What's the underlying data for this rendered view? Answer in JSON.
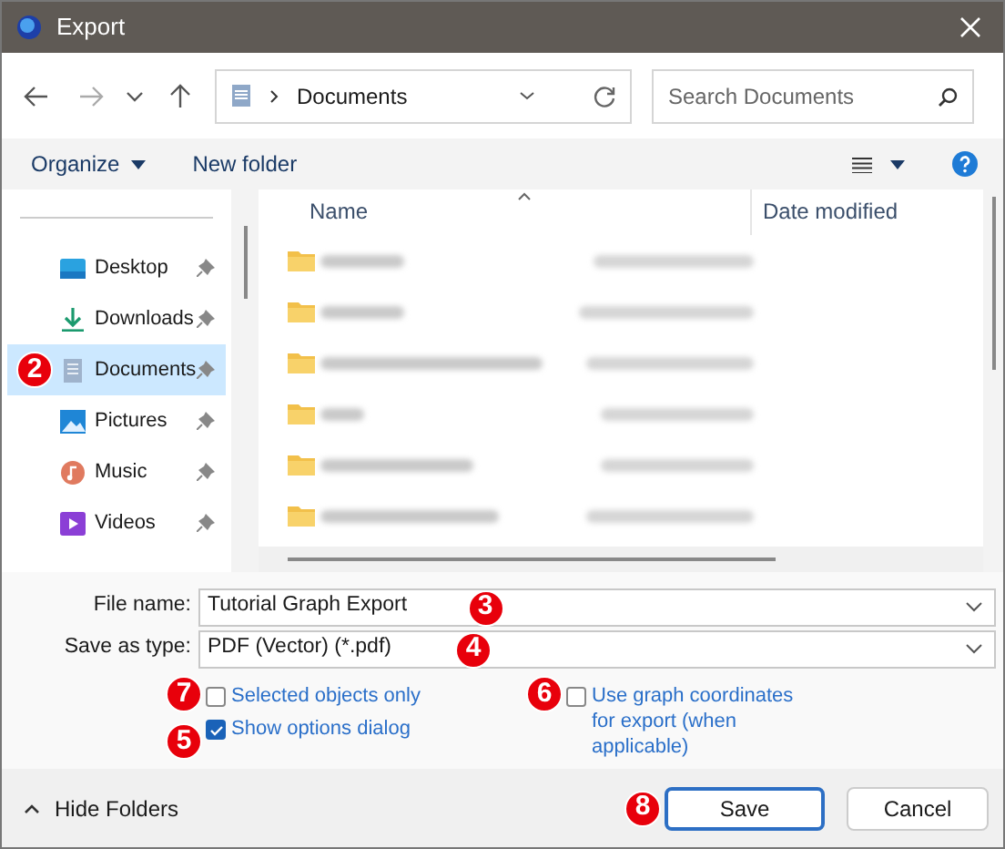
{
  "window": {
    "title": "Export"
  },
  "nav": {
    "location": "Documents",
    "search": {
      "placeholder": "Search Documents"
    }
  },
  "toolbar": {
    "organize": "Organize",
    "new_folder": "New folder"
  },
  "sidebar": {
    "items": [
      {
        "kind": "desktop",
        "label": "Desktop",
        "selected": false
      },
      {
        "kind": "downloads",
        "label": "Downloads",
        "selected": false
      },
      {
        "kind": "documents",
        "label": "Documents",
        "selected": true,
        "marker": "2"
      },
      {
        "kind": "pictures",
        "label": "Pictures",
        "selected": false
      },
      {
        "kind": "music",
        "label": "Music",
        "selected": false
      },
      {
        "kind": "videos",
        "label": "Videos",
        "selected": false
      }
    ]
  },
  "file_list": {
    "columns": [
      "Name",
      "Date modified"
    ],
    "rows": [
      {
        "kind": "folder"
      },
      {
        "kind": "folder"
      },
      {
        "kind": "folder"
      },
      {
        "kind": "folder"
      },
      {
        "kind": "folder"
      },
      {
        "kind": "folder"
      }
    ]
  },
  "form": {
    "file_name": {
      "label": "File name:",
      "value": "Tutorial Graph Export",
      "marker": "3"
    },
    "save_type": {
      "label": "Save as type:",
      "value": "PDF (Vector) (*.pdf)",
      "marker": "4"
    },
    "left_options": [
      {
        "label": "Selected objects only",
        "checked": false,
        "marker": "7"
      },
      {
        "label": "Show options dialog",
        "checked": true,
        "marker": "5"
      }
    ],
    "right_options": [
      {
        "label": "Use graph coordinates for export (when applicable)",
        "checked": false,
        "marker": "6"
      }
    ]
  },
  "footer": {
    "hide_folders": "Hide Folders",
    "save": {
      "label": "Save",
      "marker": "8"
    },
    "cancel": "Cancel"
  }
}
